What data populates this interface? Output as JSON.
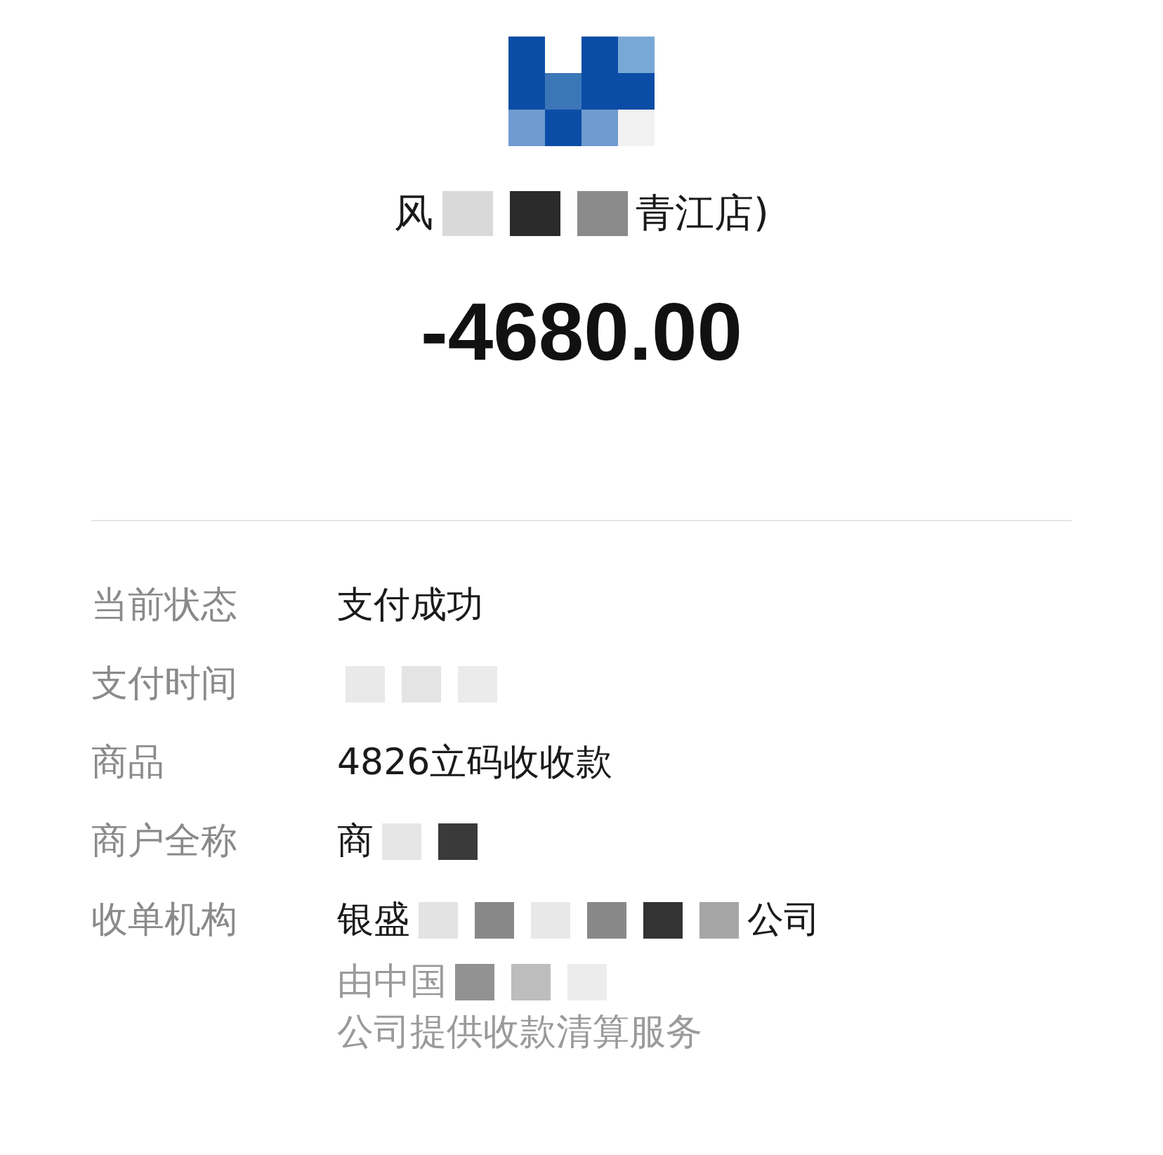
{
  "merchant": {
    "name_parts": [
      {
        "kind": "text",
        "text": "风"
      },
      {
        "kind": "mosaic",
        "color": "#d9d9d9"
      },
      {
        "kind": "mosaic",
        "color": "#2b2b2b"
      },
      {
        "kind": "mosaic",
        "color": "#8a8a8a"
      },
      {
        "kind": "text",
        "text": "青江店)"
      }
    ]
  },
  "amount": "-4680.00",
  "details": [
    {
      "label": "当前状态",
      "parts": [
        {
          "kind": "text",
          "text": "支付成功"
        }
      ]
    },
    {
      "label": "支付时间",
      "parts": [
        {
          "kind": "mosaic",
          "color": "#e9e9e9"
        },
        {
          "kind": "mosaic",
          "color": "#e4e4e4"
        },
        {
          "kind": "mosaic",
          "color": "#ebebeb"
        }
      ]
    },
    {
      "label": "商品",
      "parts": [
        {
          "kind": "text",
          "text": "4826立码收收款"
        }
      ]
    },
    {
      "label": "商户全称",
      "parts": [
        {
          "kind": "text",
          "text": "商"
        },
        {
          "kind": "mosaic",
          "color": "#e6e6e6"
        },
        {
          "kind": "mosaic",
          "color": "#3a3a3a"
        }
      ]
    },
    {
      "label": "收单机构",
      "parts": [
        {
          "kind": "text",
          "text": "银盛"
        },
        {
          "kind": "mosaic",
          "color": "#e3e3e3"
        },
        {
          "kind": "mosaic",
          "color": "#888888"
        },
        {
          "kind": "mosaic",
          "color": "#e8e8e8"
        },
        {
          "kind": "mosaic",
          "color": "#888888"
        },
        {
          "kind": "mosaic",
          "color": "#333333"
        },
        {
          "kind": "mosaic",
          "color": "#a6a6a6"
        },
        {
          "kind": "text",
          "text": "公司"
        }
      ],
      "note_parts": [
        {
          "kind": "text",
          "text": "由中国"
        },
        {
          "kind": "mosaic",
          "color": "#929292"
        },
        {
          "kind": "mosaic",
          "color": "#bdbdbd"
        },
        {
          "kind": "mosaic",
          "color": "#ececec"
        },
        {
          "kind": "text",
          "text": "公司提供收款清算服务"
        }
      ]
    }
  ]
}
